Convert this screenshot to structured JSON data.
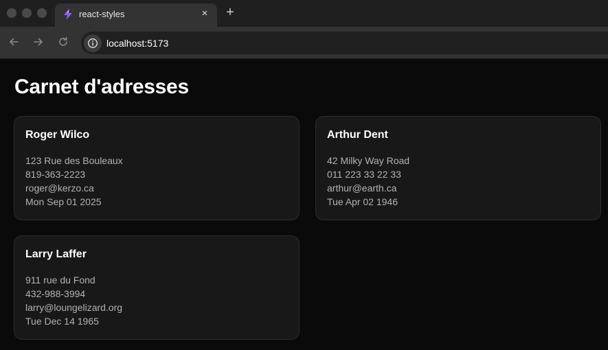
{
  "browser": {
    "tab_title": "react-styles",
    "tab_close": "×",
    "new_tab": "+",
    "url": "localhost:5173"
  },
  "page": {
    "title": "Carnet d'adresses"
  },
  "contacts": [
    {
      "name": "Roger Wilco",
      "address": "123 Rue des Bouleaux",
      "phone": "819-363-2223",
      "email": "roger@kerzo.ca",
      "date": "Mon Sep 01 2025"
    },
    {
      "name": "Arthur Dent",
      "address": "42 Milky Way Road",
      "phone": "011 223 33 22 33",
      "email": "arthur@earth.ca",
      "date": "Tue Apr 02 1946"
    },
    {
      "name": "Larry Laffer",
      "address": "911 rue du Fond",
      "phone": "432-988-3994",
      "email": "larry@loungelizard.org",
      "date": "Tue Dec 14 1965"
    }
  ],
  "colors": {
    "page_bg": "#0a0a0a",
    "card_bg": "#181818",
    "card_border": "#2c2c2c",
    "text_primary": "#ffffff",
    "text_secondary": "#b3b3b3",
    "favicon": "#8b5cf6"
  },
  "icons": {
    "favicon": "vite-bolt-icon",
    "back": "arrow-left-icon",
    "forward": "arrow-right-icon",
    "reload": "reload-icon",
    "site_info": "info-icon"
  }
}
